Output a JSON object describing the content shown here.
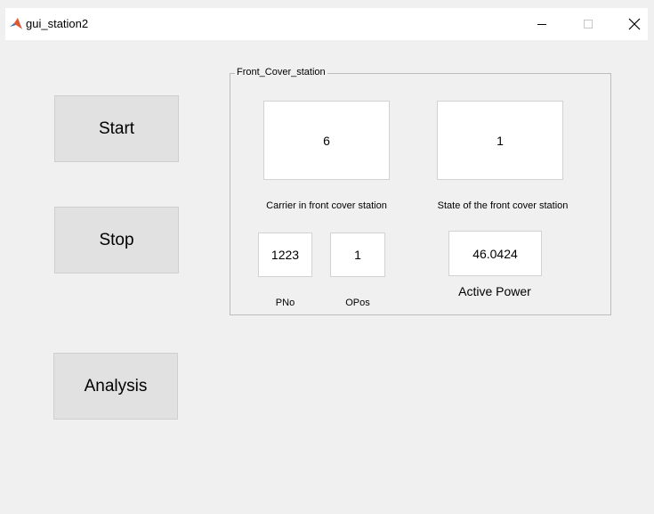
{
  "window": {
    "title": "gui_station2",
    "controls": {
      "minimize": "minimize",
      "maximize": "maximize",
      "close": "close"
    }
  },
  "buttons": {
    "start_label": "Start",
    "stop_label": "Stop",
    "analysis_label": "Analysis"
  },
  "panel": {
    "title": "Front_Cover_station",
    "carrier_value": "6",
    "carrier_label": "Carrier in front cover station",
    "state_value": "1",
    "state_label": "State of the front cover station",
    "pno_value": "1223",
    "pno_label": "PNo",
    "opos_value": "1",
    "opos_label": "OPos",
    "power_value": "46.0424",
    "power_label": "Active Power"
  },
  "colors": {
    "background": "#f0f0f0",
    "button": "#e1e1e1",
    "titlebar": "#ffffff"
  }
}
